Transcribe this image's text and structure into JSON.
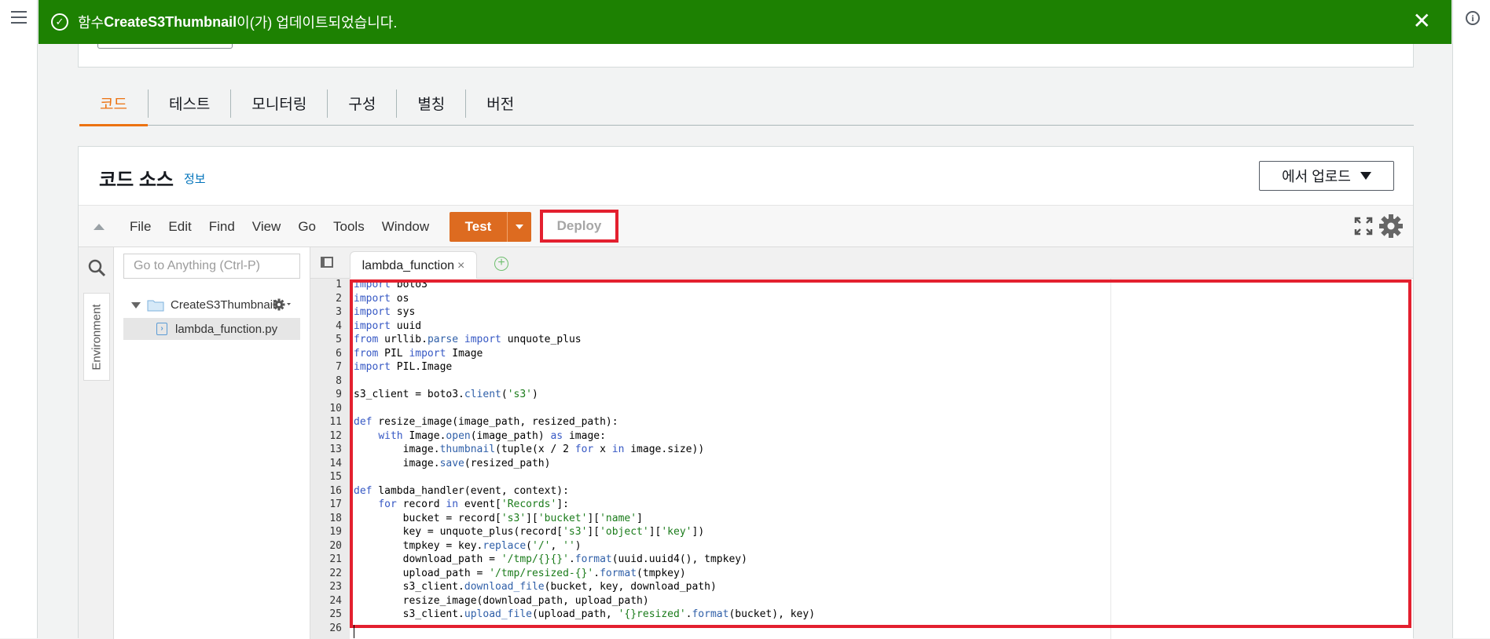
{
  "notification": {
    "prefix": "함수 ",
    "function_name": "CreateS3Thumbnail",
    "suffix": "이(가) 업데이트되었습니다.",
    "close_glyph": "✕"
  },
  "tabs": [
    {
      "label": "코드",
      "active": true
    },
    {
      "label": "테스트"
    },
    {
      "label": "모니터링"
    },
    {
      "label": "구성"
    },
    {
      "label": "별칭"
    },
    {
      "label": "버전"
    }
  ],
  "code_source": {
    "title": "코드 소스",
    "info_link": "정보",
    "upload_button": "에서 업로드"
  },
  "ide": {
    "menu": [
      "File",
      "Edit",
      "Find",
      "View",
      "Go",
      "Tools",
      "Window"
    ],
    "test_button": "Test",
    "deploy_button": "Deploy",
    "goto_placeholder": "Go to Anything (Ctrl-P)",
    "environment_tab": "Environment",
    "tree": {
      "root": "CreateS3Thumbnail",
      "file": "lambda_function.py"
    },
    "open_tab": "lambda_function",
    "close_glyph": "×",
    "add_glyph": "+"
  },
  "editor": {
    "line_numbers": [
      "1",
      "2",
      "3",
      "4",
      "5",
      "6",
      "7",
      "8",
      "9",
      "10",
      "11",
      "12",
      "13",
      "14",
      "15",
      "16",
      "17",
      "18",
      "19",
      "20",
      "21",
      "22",
      "23",
      "24",
      "25",
      "26"
    ],
    "lines": [
      "import boto3",
      "import os",
      "import sys",
      "import uuid",
      "from urllib.parse import unquote_plus",
      "from PIL import Image",
      "import PIL.Image",
      "",
      "s3_client = boto3.client('s3')",
      "",
      "def resize_image(image_path, resized_path):",
      "    with Image.open(image_path) as image:",
      "        image.thumbnail(tuple(x / 2 for x in image.size))",
      "        image.save(resized_path)",
      "",
      "def lambda_handler(event, context):",
      "    for record in event['Records']:",
      "        bucket = record['s3']['bucket']['name']",
      "        key = unquote_plus(record['s3']['object']['key'])",
      "        tmpkey = key.replace('/', '')",
      "        download_path = '/tmp/{}{}'.format(uuid.uuid4(), tmpkey)",
      "        upload_path = '/tmp/resized-{}'.format(tmpkey)",
      "        s3_client.download_file(bucket, key, download_path)",
      "        resize_image(download_path, upload_path)",
      "        s3_client.upload_file(upload_path, '{}resized'.format(bucket), key)",
      ""
    ]
  },
  "colors": {
    "success": "#1d8102",
    "accent": "#ec7211",
    "test_button": "#dd6b20",
    "highlight": "#e3202f"
  },
  "icons": [
    "menu-icon",
    "info-icon",
    "check-circle-icon",
    "close-icon",
    "caret-down-icon",
    "collapse-icon",
    "fullscreen-icon",
    "gear-icon",
    "search-icon",
    "folder-icon",
    "python-file-icon",
    "panel-icon",
    "add-tab-icon"
  ]
}
